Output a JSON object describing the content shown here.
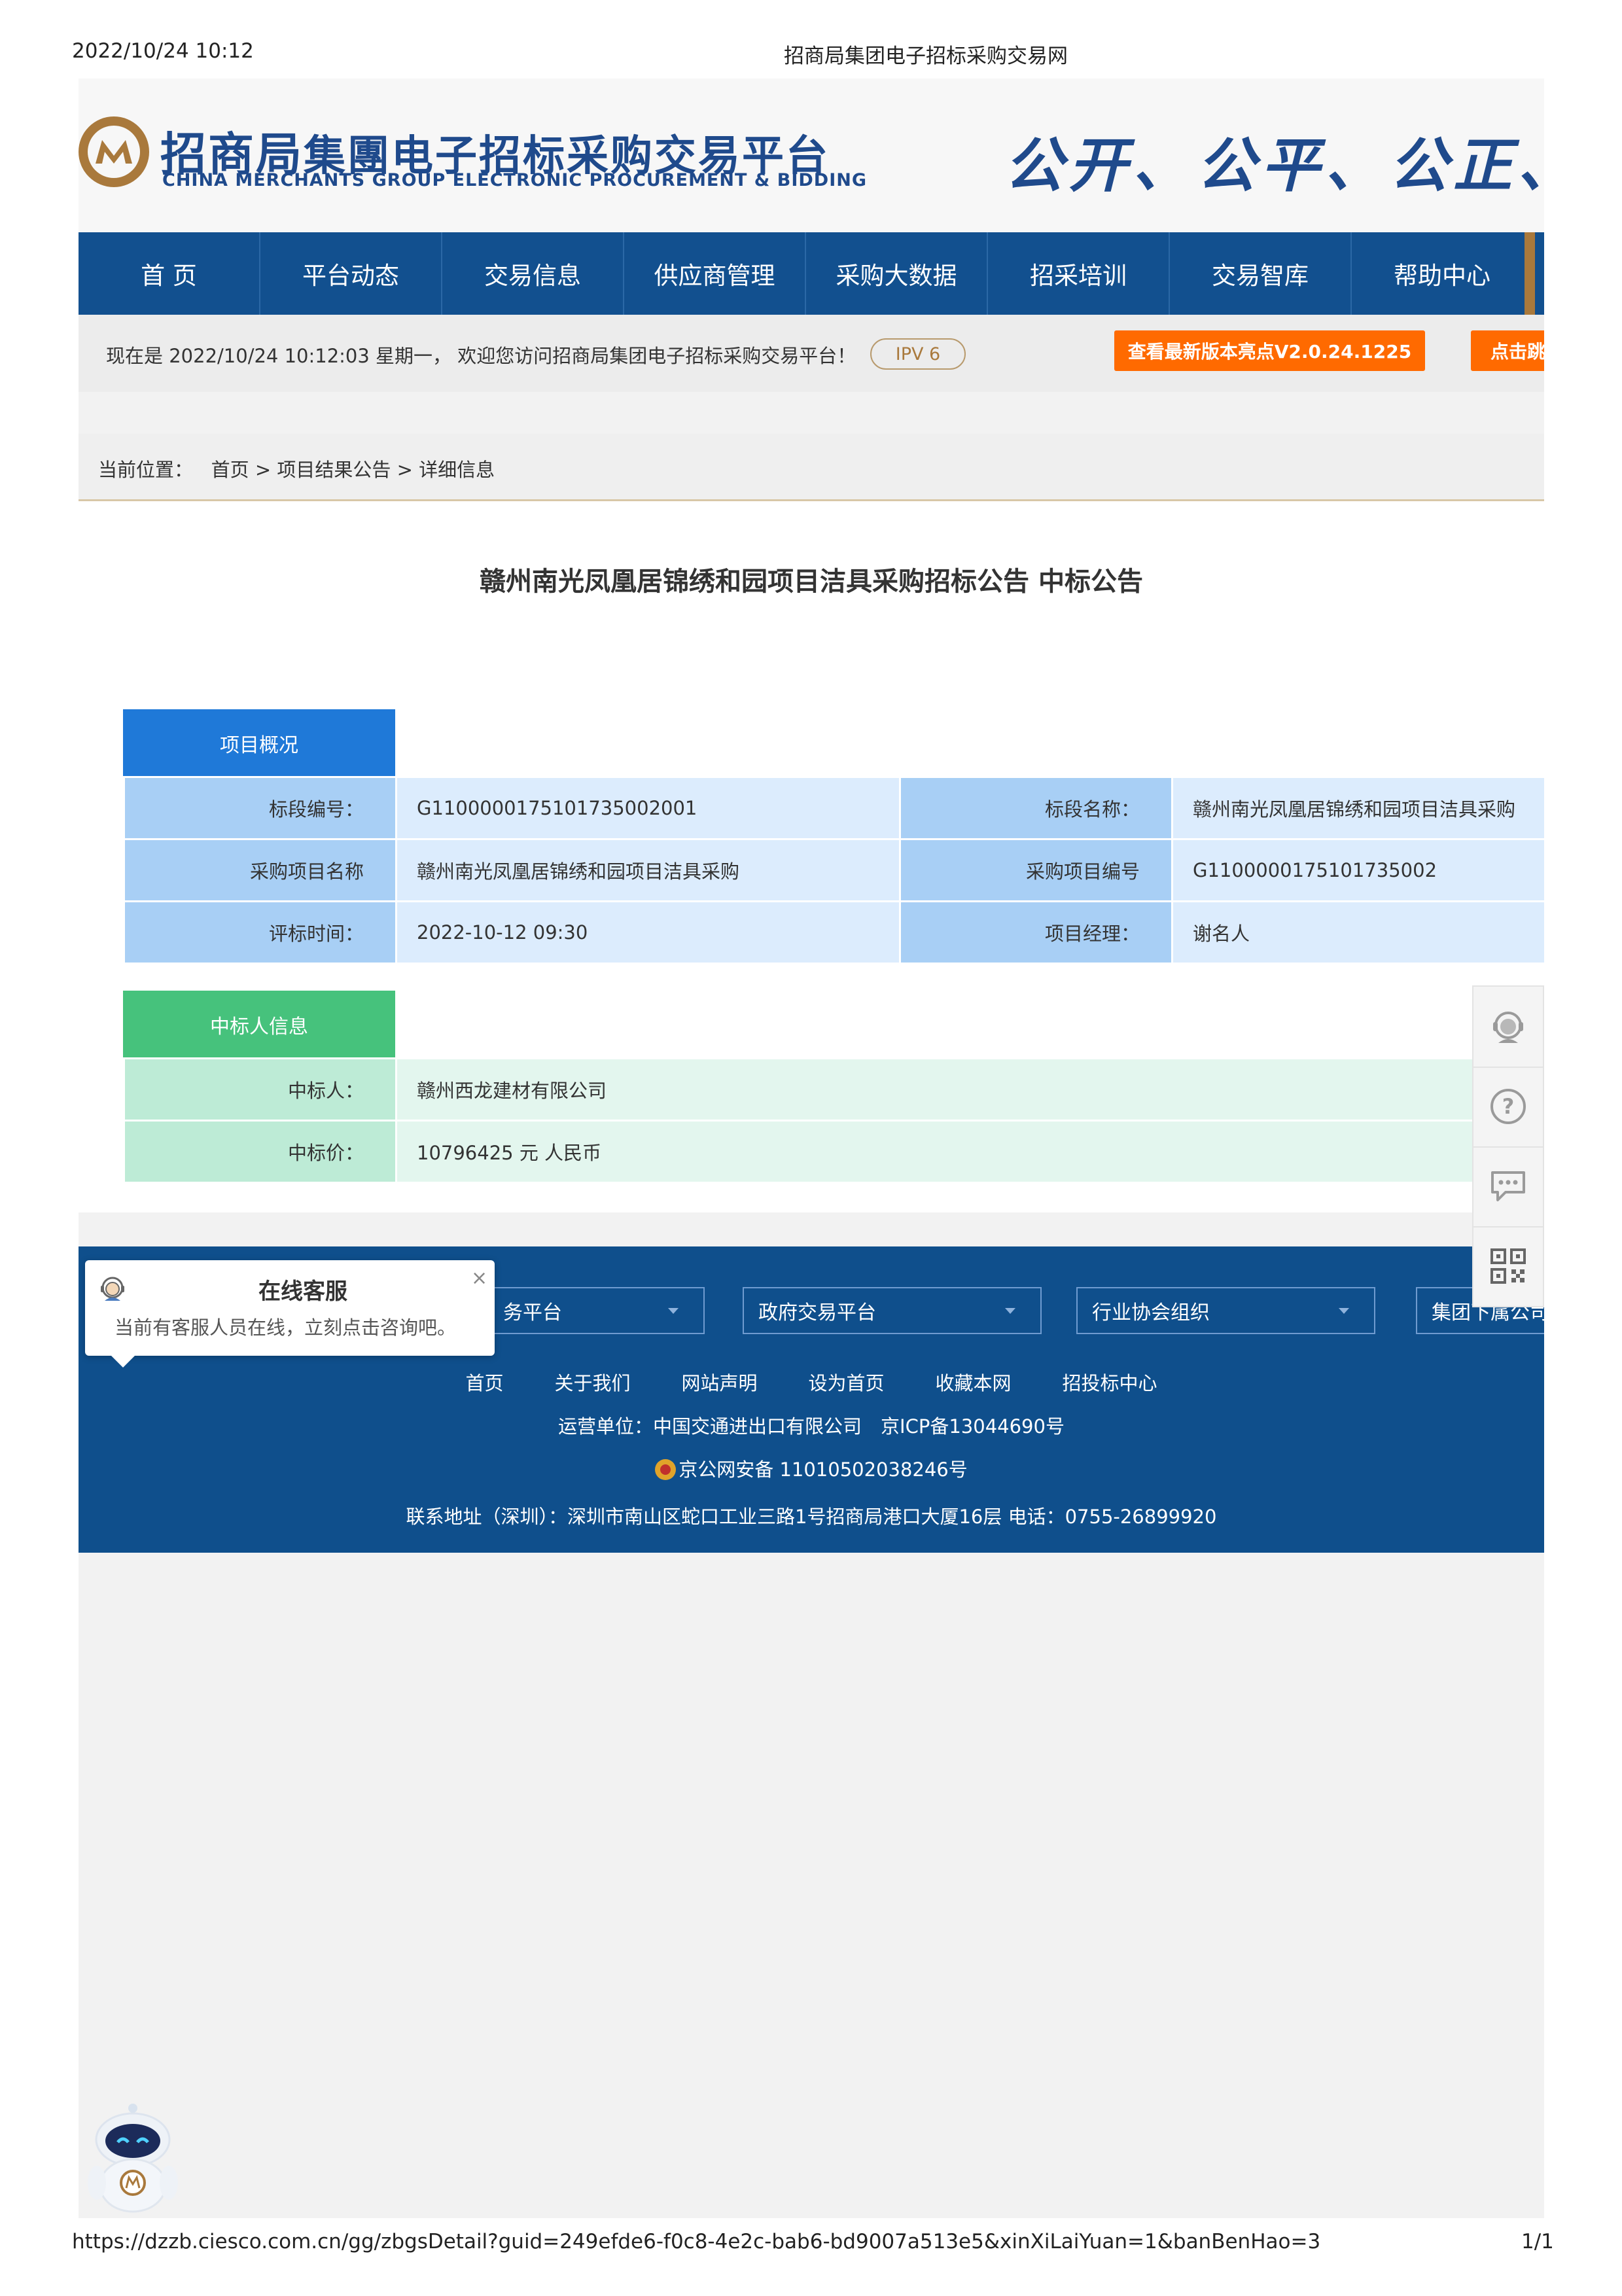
{
  "print_header": {
    "datetime": "2022/10/24 10:12",
    "page_title": "招商局集团电子招标采购交易网"
  },
  "header": {
    "logo_cn_main": "招商局",
    "logo_cn_rest": "集團电子招标采购交易平台",
    "logo_en": "CHINA MERCHANTS GROUP ELECTRONIC PROCUREMENT & BIDDING",
    "slogan": "公开、公平、公正、诚"
  },
  "nav": {
    "items": [
      "首 页",
      "平台动态",
      "交易信息",
      "供应商管理",
      "采购大数据",
      "招采培训",
      "交易智库",
      "帮助中心"
    ]
  },
  "infobar": {
    "welcome": "现在是 2022/10/24 10:12:03 星期一， 欢迎您访问招商局集团电子招标采购交易平台！",
    "ipv6": "IPV 6",
    "version_button": "查看最新版本亮点V2.0.24.1225",
    "jump_button": "点击跳"
  },
  "breadcrumb": {
    "label": "当前位置：",
    "path": "首页 > 项目结果公告 > 详细信息"
  },
  "notice": {
    "title": "赣州南光凤凰居锦绣和园项目洁具采购招标公告 中标公告",
    "section1_title": "项目概况",
    "section1_rows": [
      [
        "标段编号：",
        "G1100000175101735002001",
        "标段名称：",
        "赣州南光凤凰居锦绣和园项目洁具采购"
      ],
      [
        "采购项目名称",
        "赣州南光凤凰居锦绣和园项目洁具采购",
        "采购项目编号",
        "G1100000175101735002"
      ],
      [
        "评标时间：",
        "2022-10-12 09:30",
        "项目经理：",
        "谢名人"
      ]
    ],
    "section2_title": "中标人信息",
    "section2_rows": [
      [
        "中标人：",
        "赣州西龙建材有限公司"
      ],
      [
        "中标价：",
        "10796425 元 人民币"
      ]
    ]
  },
  "footer": {
    "selects": [
      "务平台",
      "政府交易平台",
      "行业协会组织",
      "集团下属公司"
    ],
    "links": [
      "首页",
      "关于我们",
      "网站声明",
      "设为首页",
      "收藏本网",
      "招投标中心"
    ],
    "operator": "运营单位：中国交通进出口有限公司　京ICP备13044690号",
    "police": "京公网安备 11010502038246号",
    "address": "联系地址（深圳）：深圳市南山区蛇口工业三路1号招商局港口大厦16层  电话：0755-26899920"
  },
  "popup": {
    "title": "在线客服",
    "message": "当前有客服人员在线，立刻点击咨询吧。",
    "close": "×"
  },
  "sidebar": {
    "help_glyph": "?"
  },
  "print_footer": {
    "url": "https://dzzb.ciesco.com.cn/gg/zbgsDetail?guid=249efde6-f0c8-4e2c-bab6-bd9007a513e5&xinXiLaiYuan=1&banBenHao=3",
    "page": "1/1"
  },
  "colors": {
    "nav_blue": "#12508f",
    "accent_gold": "#a9793c",
    "orange": "#ff6a00",
    "section1_blue": "#1f79d8",
    "section2_green": "#46c27c"
  }
}
